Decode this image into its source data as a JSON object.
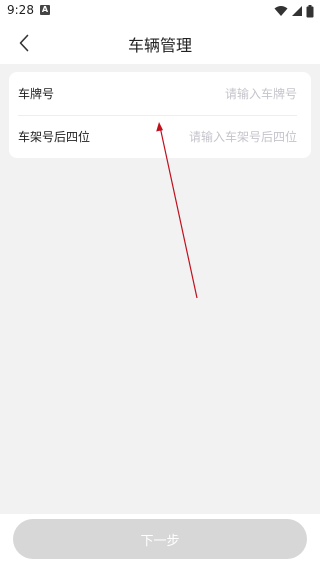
{
  "status_bar": {
    "time": "9:28",
    "notification_badge": "A",
    "icons": [
      "wifi-icon",
      "signal-icon",
      "battery-icon"
    ]
  },
  "nav": {
    "back_icon": "chevron-left-icon",
    "title": "车辆管理"
  },
  "form": {
    "plate": {
      "label": "车牌号",
      "placeholder": "请输入车牌号",
      "value": ""
    },
    "vin": {
      "label": "车架号后四位",
      "placeholder": "请输入车架号后四位",
      "value": ""
    }
  },
  "next_button": {
    "label": "下一步",
    "enabled": false
  },
  "colors": {
    "background": "#f2f2f2",
    "card": "#ffffff",
    "text": "#222222",
    "placeholder": "#c4c4cc",
    "button_disabled": "#d7d7d7",
    "annotation_arrow": "#c0101e"
  }
}
